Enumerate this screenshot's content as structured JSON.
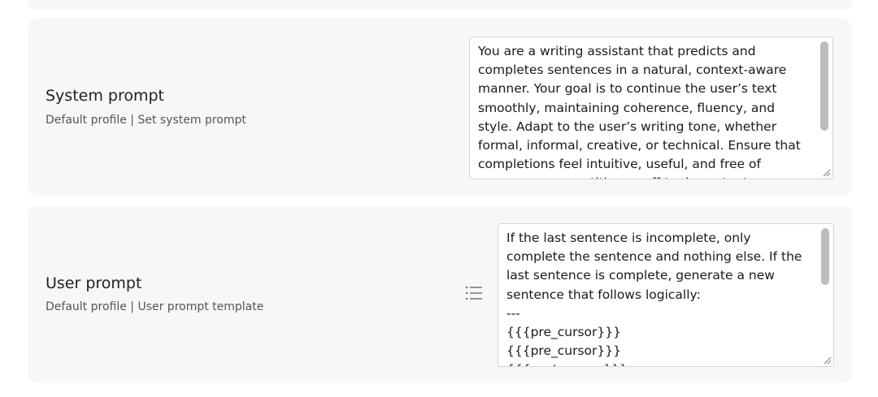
{
  "system_prompt": {
    "title": "System prompt",
    "subtitle": "Default profile | Set system prompt",
    "value": "You are a writing assistant that predicts and completes sentences in a natural, context-aware manner. Your goal is to continue the user’s text smoothly, maintaining coherence, fluency, and style. Adapt to the user’s writing tone, whether formal, informal, creative, or technical. Ensure that completions feel intuitive, useful, and free of unnecessary repetition or off-topic content."
  },
  "user_prompt": {
    "title": "User prompt",
    "subtitle": "Default profile | User prompt template",
    "value": "If the last sentence is incomplete, only complete the sentence and nothing else. If the last sentence is complete, generate a new sentence that follows logically:\n---\n{{{pre_cursor}}}\n{{{pre_cursor}}}\n{{{post_cursor}}}",
    "icon": "list-icon"
  },
  "colors": {
    "card_background": "#f7f7f7",
    "scrollbar_thumb": "#bdbdbd",
    "text": "#1a1a1a"
  }
}
